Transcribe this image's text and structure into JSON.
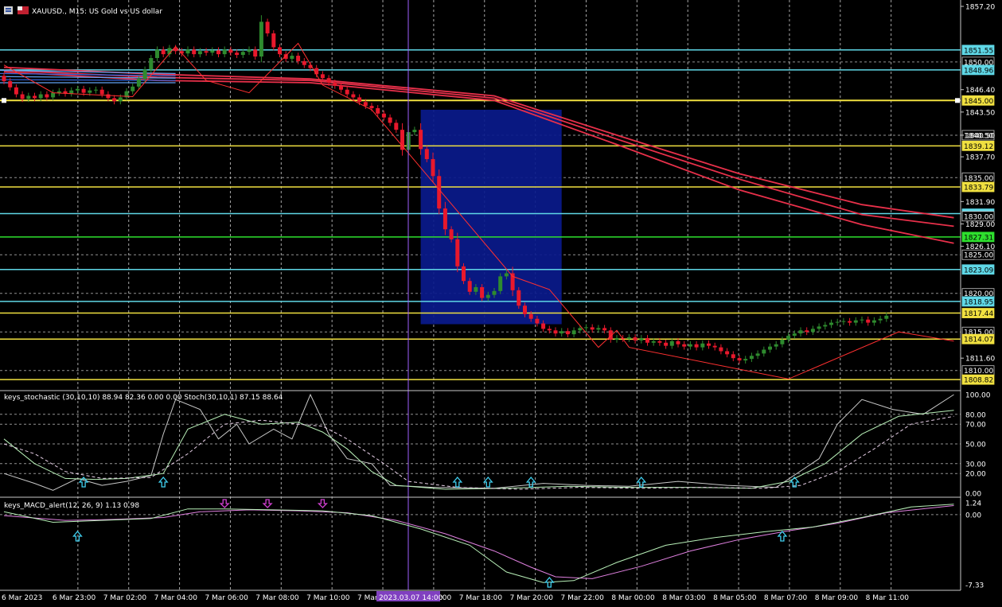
{
  "window": {
    "symbol_title": "XAUUSD., M15: US Gold vs US dollar"
  },
  "colors": {
    "background": "#000000",
    "bull": "#2e8b2e",
    "bear": "#e8182c",
    "ma": "#e8304a",
    "cyan_line": "#5fd7e6",
    "yellow_line": "#f0e040",
    "green_line": "#2ee02e",
    "zone": "#0a1a8c",
    "grid": "#d0d0d0",
    "stoch_main": "#b8f0b8",
    "stoch_raw": "#c8c8c8",
    "macd_main": "#b8f0b8",
    "macd_signal": "#e080e0",
    "buy_arrow": "#40d0f0",
    "sell_arrow": "#d040d0",
    "crosshair": "#a060ff"
  },
  "price_axis": {
    "max": 1857.2,
    "min": 1807.7,
    "ticks": [
      "1857.20",
      "1846.40",
      "1843.50",
      "1840.50",
      "1837.70",
      "1831.90",
      "1829.00",
      "1826.10",
      "1811.60"
    ],
    "grid_levels": [
      1850.0,
      1840.5,
      1835.0,
      1825.0,
      1820.0,
      1815.0,
      1810.0
    ]
  },
  "levels": [
    {
      "price": 1851.55,
      "label": "1851.55",
      "color": "#5fd7e6",
      "kind": "cyan"
    },
    {
      "price": 1850.0,
      "label": "1850.00",
      "color": "#c8c8c8",
      "kind": "round"
    },
    {
      "price": 1848.96,
      "label": "1848.96",
      "color": "#5fd7e6",
      "kind": "cyan"
    },
    {
      "price": 1845.0,
      "label": "1845.00",
      "color": "#f0e040",
      "kind": "yellow"
    },
    {
      "price": 1840.5,
      "label": "1840.50",
      "color": "#c8c8c8",
      "kind": "round"
    },
    {
      "price": 1839.12,
      "label": "1839.12",
      "color": "#f0e040",
      "kind": "yellow"
    },
    {
      "price": 1835.0,
      "label": "1835.00",
      "color": "#c8c8c8",
      "kind": "round"
    },
    {
      "price": 1833.79,
      "label": "1833.79",
      "color": "#f0e040",
      "kind": "yellow"
    },
    {
      "price": 1830.33,
      "label": "1830.33",
      "color": "#5fd7e6",
      "kind": "cyan"
    },
    {
      "price": 1830.0,
      "label": "1830.00",
      "color": "#c8c8c8",
      "kind": "round"
    },
    {
      "price": 1827.31,
      "label": "1827.31",
      "color": "#2ee02e",
      "kind": "green"
    },
    {
      "price": 1825.0,
      "label": "1825.00",
      "color": "#c8c8c8",
      "kind": "round"
    },
    {
      "price": 1823.09,
      "label": "1823.09",
      "color": "#5fd7e6",
      "kind": "cyan"
    },
    {
      "price": 1820.0,
      "label": "1820.00",
      "color": "#c8c8c8",
      "kind": "round"
    },
    {
      "price": 1818.95,
      "label": "1818.95",
      "color": "#5fd7e6",
      "kind": "cyan"
    },
    {
      "price": 1817.44,
      "label": "1817.44",
      "color": "#f0e040",
      "kind": "yellow"
    },
    {
      "price": 1815.0,
      "label": "1815.00",
      "color": "#c8c8c8",
      "kind": "round"
    },
    {
      "price": 1814.07,
      "label": "1814.07",
      "color": "#f0e040",
      "kind": "yellow"
    },
    {
      "price": 1810.0,
      "label": "1810.00",
      "color": "#c8c8c8",
      "kind": "round"
    },
    {
      "price": 1808.82,
      "label": "1808.82",
      "color": "#f0e040",
      "kind": "yellow"
    }
  ],
  "time_axis": {
    "labels": [
      "6 Mar 2023",
      "6 Mar 23:00",
      "7 Mar 02:00",
      "7 Mar 04:00",
      "7 Mar 06:00",
      "7 Mar 08:00",
      "7 Mar 10:00",
      "7 Mar",
      "7 Mar 16:00",
      "7 Mar 18:00",
      "7 Mar 20:00",
      "7 Mar 22:00",
      "8 Mar 00:00",
      "8 Mar 03:00",
      "8 Mar 05:00",
      "8 Mar 07:00",
      "8 Mar 09:00",
      "8 Mar 11:00"
    ],
    "cursor_label": "2023.03.07 14:00"
  },
  "candles": {
    "start": 1848.2,
    "moves": [
      -0.7,
      -0.8,
      -0.9,
      -0.6,
      0.4,
      -0.3,
      0.5,
      -0.4,
      0.6,
      0.2,
      -0.3,
      0.4,
      0.2,
      -0.5,
      0.3,
      0.1,
      -0.6,
      -0.5,
      -0.4,
      0.5,
      0.8,
      0.6,
      1.0,
      1.2,
      1.5,
      1.1,
      -0.6,
      0.8,
      -0.4,
      -0.3,
      0.5,
      -0.6,
      0.4,
      -0.2,
      0.3,
      -0.5,
      0.6,
      -0.4,
      -0.3,
      0.4,
      0.3,
      -0.9,
      4.5,
      -1.5,
      -1.8,
      -0.9,
      -0.6,
      0.4,
      -0.7,
      -0.5,
      -0.4,
      -0.8,
      -0.5,
      -0.6,
      -0.4,
      -0.5,
      -0.6,
      -0.4,
      -0.6,
      -0.5,
      -0.3,
      -0.7,
      -0.5,
      -0.7,
      -0.9,
      -2.6,
      2.3,
      0.3,
      -2.5,
      -1.3,
      -2.2,
      -4.2,
      -2.7,
      -1.3,
      -3.5,
      -1.9,
      -1.4,
      0.6,
      -1.4,
      0.4,
      0.5,
      1.9,
      0.4,
      -2.2,
      -2.0,
      -1.1,
      -0.6,
      -0.6,
      -0.7,
      -0.2,
      -0.4,
      0.3,
      -0.4,
      0.5,
      0.3,
      0.1,
      -0.3,
      0.2,
      -0.3,
      -1.2,
      0.2,
      -0.1,
      0.2,
      -0.4,
      0.3,
      -0.6,
      0.2,
      -0.2,
      -0.4,
      0.6,
      -0.4,
      -0.3,
      0.3,
      -0.4,
      0.5,
      -0.3,
      -0.2,
      -0.5,
      -0.4,
      -0.5,
      -0.3,
      0.2,
      0.4,
      0.3,
      0.5,
      0.4,
      0.3,
      0.6,
      0.5,
      0.3,
      0.4,
      -0.2,
      0.4,
      0.3,
      0.2,
      0.3,
      0.1,
      0.1,
      -0.2,
      0.3,
      0.1,
      -0.4,
      0.3,
      0.2,
      0.4
    ]
  },
  "moving_averages": [
    {
      "name": "ma-1",
      "points": [
        [
          0,
          1849.3
        ],
        [
          25,
          1848.4
        ],
        [
          50,
          1847.8
        ],
        [
          80,
          1845.6
        ],
        [
          100,
          1840.5
        ],
        [
          120,
          1835.5
        ],
        [
          140,
          1831.5
        ],
        [
          155,
          1829.8
        ]
      ]
    },
    {
      "name": "ma-2",
      "points": [
        [
          0,
          1848.9
        ],
        [
          25,
          1848.0
        ],
        [
          50,
          1847.6
        ],
        [
          80,
          1845.3
        ],
        [
          100,
          1840.0
        ],
        [
          120,
          1834.8
        ],
        [
          140,
          1830.2
        ],
        [
          155,
          1828.7
        ]
      ]
    },
    {
      "name": "ma-3",
      "points": [
        [
          0,
          1848.7
        ],
        [
          25,
          1847.6
        ],
        [
          50,
          1847.3
        ],
        [
          80,
          1845.0
        ],
        [
          100,
          1839.3
        ],
        [
          120,
          1833.4
        ],
        [
          140,
          1828.9
        ],
        [
          155,
          1826.5
        ]
      ]
    }
  ],
  "zigzag": [
    [
      0,
      1849.6
    ],
    [
      8,
      1846.0
    ],
    [
      21,
      1845.5
    ],
    [
      28,
      1852.0
    ],
    [
      33,
      1847.6
    ],
    [
      40,
      1846.0
    ],
    [
      48,
      1852.4
    ],
    [
      52,
      1847.0
    ],
    [
      60,
      1843.8
    ],
    [
      83,
      1822.2
    ],
    [
      89,
      1820.5
    ],
    [
      97,
      1813.0
    ],
    [
      100,
      1815.2
    ],
    [
      102,
      1813.0
    ],
    [
      128,
      1808.9
    ],
    [
      146,
      1815.0
    ],
    [
      155,
      1813.8
    ]
  ],
  "zone": {
    "from_bar": 68,
    "to_bar": 91,
    "top": 1843.8,
    "bottom": 1816.0
  },
  "stochastic": {
    "title": "keys_stochastic (30,10,10) 88.94 82.36 0.00 0.00 Stoch(30,10,1) 87.15 88.64",
    "ticks": [
      "100.00",
      "80.00",
      "70.00",
      "50.00",
      "30.00",
      "20.00",
      "0.00"
    ],
    "grid_levels": [
      80,
      70,
      50,
      30,
      20
    ],
    "raw": [
      [
        0,
        20
      ],
      [
        5,
        10
      ],
      [
        8,
        3
      ],
      [
        12,
        15
      ],
      [
        16,
        8
      ],
      [
        20,
        12
      ],
      [
        24,
        18
      ],
      [
        26,
        60
      ],
      [
        28,
        95
      ],
      [
        32,
        85
      ],
      [
        35,
        55
      ],
      [
        38,
        70
      ],
      [
        40,
        50
      ],
      [
        44,
        65
      ],
      [
        47,
        55
      ],
      [
        50,
        100
      ],
      [
        53,
        60
      ],
      [
        56,
        35
      ],
      [
        60,
        30
      ],
      [
        63,
        8
      ],
      [
        70,
        6
      ],
      [
        80,
        5
      ],
      [
        88,
        10
      ],
      [
        95,
        8
      ],
      [
        102,
        7
      ],
      [
        110,
        12
      ],
      [
        118,
        8
      ],
      [
        126,
        6
      ],
      [
        133,
        35
      ],
      [
        136,
        70
      ],
      [
        140,
        95
      ],
      [
        145,
        85
      ],
      [
        150,
        80
      ],
      [
        155,
        100
      ]
    ],
    "main": [
      [
        0,
        55
      ],
      [
        5,
        30
      ],
      [
        10,
        15
      ],
      [
        15,
        14
      ],
      [
        20,
        15
      ],
      [
        26,
        20
      ],
      [
        30,
        65
      ],
      [
        36,
        80
      ],
      [
        42,
        70
      ],
      [
        48,
        72
      ],
      [
        52,
        62
      ],
      [
        56,
        45
      ],
      [
        60,
        22
      ],
      [
        64,
        8
      ],
      [
        72,
        4
      ],
      [
        82,
        5
      ],
      [
        92,
        7
      ],
      [
        102,
        6
      ],
      [
        112,
        6
      ],
      [
        122,
        5
      ],
      [
        128,
        12
      ],
      [
        134,
        30
      ],
      [
        140,
        60
      ],
      [
        146,
        78
      ],
      [
        152,
        82
      ],
      [
        155,
        84
      ]
    ],
    "signal": [
      [
        0,
        50
      ],
      [
        5,
        40
      ],
      [
        10,
        22
      ],
      [
        16,
        15
      ],
      [
        24,
        16
      ],
      [
        30,
        40
      ],
      [
        36,
        70
      ],
      [
        42,
        74
      ],
      [
        48,
        70
      ],
      [
        52,
        68
      ],
      [
        56,
        55
      ],
      [
        62,
        30
      ],
      [
        66,
        12
      ],
      [
        74,
        6
      ],
      [
        84,
        4
      ],
      [
        94,
        6
      ],
      [
        104,
        5
      ],
      [
        114,
        6
      ],
      [
        124,
        5
      ],
      [
        130,
        8
      ],
      [
        136,
        22
      ],
      [
        142,
        45
      ],
      [
        148,
        70
      ],
      [
        155,
        78
      ]
    ],
    "buy_arrows": [
      13,
      26,
      74,
      79,
      86,
      104,
      129
    ]
  },
  "macd": {
    "title": "keys_MACD_alert(12, 26, 9) 1.13 0.98",
    "ticks": [
      "1.24",
      "0.00",
      "-7.33"
    ],
    "main": [
      [
        0,
        0.3
      ],
      [
        8,
        -0.8
      ],
      [
        16,
        -0.6
      ],
      [
        24,
        -0.4
      ],
      [
        30,
        0.6
      ],
      [
        36,
        0.6
      ],
      [
        44,
        0.5
      ],
      [
        52,
        0.4
      ],
      [
        60,
        -0.1
      ],
      [
        68,
        -1.5
      ],
      [
        76,
        -3.2
      ],
      [
        82,
        -6.0
      ],
      [
        88,
        -7.1
      ],
      [
        93,
        -6.9
      ],
      [
        100,
        -5.0
      ],
      [
        108,
        -3.2
      ],
      [
        116,
        -2.4
      ],
      [
        124,
        -1.8
      ],
      [
        132,
        -1.3
      ],
      [
        140,
        -0.3
      ],
      [
        148,
        0.8
      ],
      [
        155,
        1.1
      ]
    ],
    "signal": [
      [
        0,
        -0.1
      ],
      [
        10,
        -0.6
      ],
      [
        18,
        -0.5
      ],
      [
        26,
        -0.3
      ],
      [
        32,
        0.3
      ],
      [
        40,
        0.5
      ],
      [
        48,
        0.4
      ],
      [
        56,
        0.2
      ],
      [
        64,
        -0.6
      ],
      [
        72,
        -2.0
      ],
      [
        80,
        -3.8
      ],
      [
        86,
        -5.5
      ],
      [
        90,
        -6.5
      ],
      [
        96,
        -6.7
      ],
      [
        104,
        -5.4
      ],
      [
        112,
        -3.8
      ],
      [
        120,
        -2.6
      ],
      [
        128,
        -1.7
      ],
      [
        136,
        -0.9
      ],
      [
        144,
        0.2
      ],
      [
        155,
        0.95
      ]
    ],
    "buy_arrows": [
      12,
      89,
      127
    ],
    "sell_arrows": [
      36,
      43,
      52
    ]
  }
}
